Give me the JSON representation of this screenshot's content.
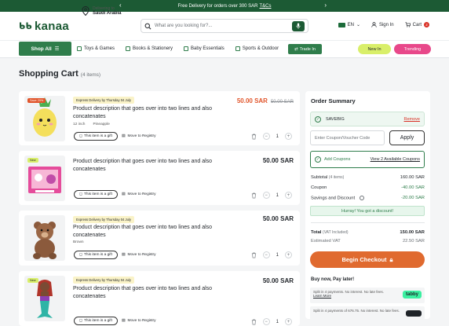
{
  "promo": {
    "text": "Free Delivery for orders over 300 SAR",
    "link": "T&Cs"
  },
  "header": {
    "logo": "kanaa",
    "deliver_label": "Delivering to",
    "deliver_location": "Saudi Arabia",
    "search_placeholder": "What are you looking for?...",
    "language": "EN",
    "sign_in": "Sign In",
    "cart": "Cart",
    "cart_count": "2"
  },
  "nav": {
    "shop_all": "Shop All",
    "links": [
      "Toys & Games",
      "Books & Stationery",
      "Baby Essentials",
      "Sports & Outdoor"
    ],
    "trade_in": "Trade In",
    "new_in": "New In",
    "trending": "Trending"
  },
  "page": {
    "title": "Shopping Cart",
    "count": "(4 items)"
  },
  "items": [
    {
      "tag": "Save 20%",
      "express": "Express Delivery by Thursday 04 July",
      "desc": "Product description that goes over into two lines and also concatenates",
      "meta1": "12 inch",
      "meta2": "Pineapple",
      "price": "50.00 SAR",
      "old_price": "50.00 SAR",
      "qty": "1"
    },
    {
      "tag": "New",
      "express": "",
      "desc": "Product description that goes over into two lines and also concatenates",
      "meta1": "",
      "meta2": "",
      "price": "50.00 SAR",
      "old_price": "",
      "qty": "1"
    },
    {
      "tag": "",
      "express": "Express Delivery by Thursday 04 July",
      "desc": "Product description that goes over into two lines and also concatenates",
      "meta1": "Brown",
      "meta2": "",
      "price": "50.00 SAR",
      "old_price": "",
      "qty": "1"
    },
    {
      "tag": "New",
      "express": "Express Delivery by Thursday 04 July",
      "desc": "Product description that goes over into two lines and also concatenates",
      "meta1": "",
      "meta2": "",
      "price": "50.00 SAR",
      "old_price": "",
      "qty": "1"
    }
  ],
  "item_actions": {
    "gift": "This item is a gift",
    "registry": "Move to Registry"
  },
  "summary": {
    "title": "Order Summary",
    "coupon_code": "SAVEBIG",
    "remove": "Remove",
    "coupon_placeholder": "Enter Coupon/Voucher Code",
    "apply": "Apply",
    "add_coupons": "Add Coupons",
    "view_coupons": "View 2 Available Coupons",
    "subtotal_label": "Subtotal",
    "subtotal_note": "(4 items)",
    "subtotal": "160.00 SAR",
    "coupon_label": "Coupon",
    "coupon": "-40.00 SAR",
    "savings_label": "Savings and Discount",
    "savings": "-20.00 SAR",
    "hurray": "Hurray! You got a discount!",
    "total_label": "Total",
    "total_note": "(VAT Included)",
    "total": "150.00 SAR",
    "vat_label": "Estimated VAT",
    "vat": "22.50 SAR",
    "checkout": "Begin Checkout",
    "bnpl": "Buy now, Pay later!",
    "pay1_text": "Split in 4 payments. No interest. No late fees.",
    "pay1_link": "Learn More",
    "pay1_brand": "tabby",
    "pay2_text": "Split in 4 payments of 676.75. No interest. No late fees."
  },
  "colors": {
    "brand": "#1c5a34",
    "accent": "#2f7d4b",
    "sale": "#e1552b",
    "checkout": "#e06a2f"
  }
}
